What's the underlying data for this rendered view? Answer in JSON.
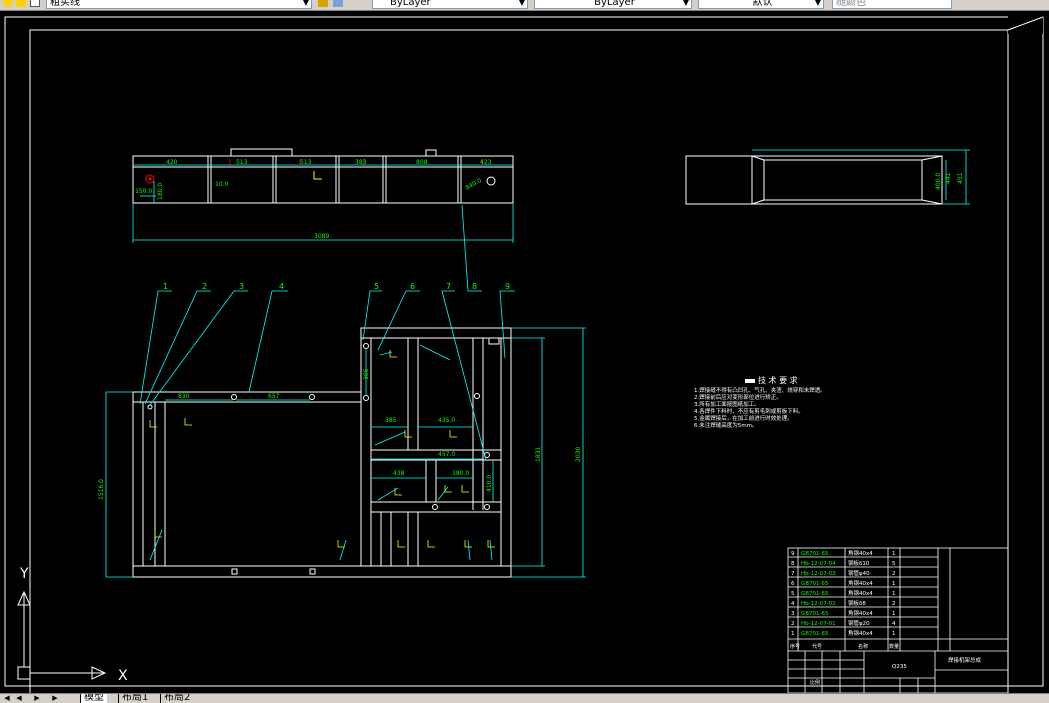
{
  "toolbar": {
    "layer_name": "粗实线",
    "color": "ByLayer",
    "linetype": "ByLayer",
    "lineweight": "默认",
    "plotstyle": "随颜色"
  },
  "ucs": {
    "x_label": "X",
    "y_label": "Y"
  },
  "top_view": {
    "dims": [
      "420",
      "513",
      "513",
      "383",
      "808",
      "423",
      "150.0",
      "180.0",
      "10.0",
      "3089",
      "840.0"
    ]
  },
  "side_view": {
    "dims": [
      "400.0",
      "441",
      "451"
    ]
  },
  "front_view": {
    "balloons": [
      "1",
      "2",
      "3",
      "4",
      "5",
      "6",
      "7",
      "8",
      "9"
    ],
    "dims": [
      "830",
      "657",
      "1516.0",
      "385",
      "385",
      "435.0",
      "457.0",
      "438",
      "380.0",
      "410.0",
      "1831",
      "2030"
    ]
  },
  "tech_requirements": {
    "title": "技 术 要 求",
    "lines": [
      "1.焊接缝不得有凸凹孔、气孔、夹渣、烧穿和未焊透。",
      "2.焊接前后应对变形部位进行矫正。",
      "3.所有加工面按图纸加工。",
      "4.各焊件下料时，不应有剪毛刺或剪板下料。",
      "5.金属焊接后，在加工前进行时效处理。",
      "6.未注焊缝高度为5mm。"
    ]
  },
  "bom": {
    "rows": [
      {
        "no": "9",
        "code": "GB701-65",
        "spec": "角钢40x4",
        "qty": "1"
      },
      {
        "no": "8",
        "code": "Hb-12-07-04",
        "spec": "钢板δ10",
        "qty": "5"
      },
      {
        "no": "7",
        "code": "Hb-12-07-03",
        "spec": "钢管φ40",
        "qty": "2"
      },
      {
        "no": "6",
        "code": "GB701-65",
        "spec": "角钢40x4",
        "qty": "1"
      },
      {
        "no": "5",
        "code": "GB701-65",
        "spec": "角钢40x4",
        "qty": "1"
      },
      {
        "no": "4",
        "code": "Hb-12-07-02",
        "spec": "钢板δ8",
        "qty": "2"
      },
      {
        "no": "3",
        "code": "GB701-65",
        "spec": "角钢40x4",
        "qty": "1"
      },
      {
        "no": "2",
        "code": "Hb-12-07-01",
        "spec": "钢管φ20",
        "qty": "4"
      },
      {
        "no": "1",
        "code": "GB701-65",
        "spec": "角钢40x4",
        "qty": "1"
      }
    ],
    "header": [
      "序号",
      "代号",
      "名称",
      "数量"
    ],
    "material": "Q235",
    "drawing_title": "焊接机架总成",
    "scale_label": "比例"
  },
  "layout_tabs": [
    "模型",
    "布局1",
    "布局2"
  ],
  "colors": {
    "bg": "#000000",
    "white": "#ffffff",
    "cyan": "#00ffff",
    "green": "#00ff00",
    "red": "#ff0000",
    "yellow": "#ffff00"
  }
}
